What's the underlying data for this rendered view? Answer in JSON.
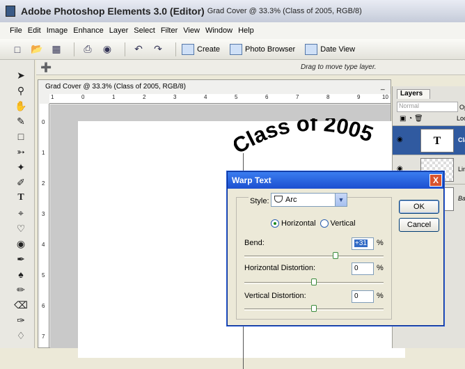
{
  "window": {
    "app_title": "Adobe Photoshop Elements 3.0 (Editor)",
    "doc_title": "Grad Cover @ 33.3% (Class of 2005, RGB/8)"
  },
  "menu": [
    "File",
    "Edit",
    "Image",
    "Enhance",
    "Layer",
    "Select",
    "Filter",
    "View",
    "Window",
    "Help"
  ],
  "toolbar": {
    "create": "Create",
    "photo_browser": "Photo Browser",
    "date_view": "Date View"
  },
  "options_bar": {
    "hint": "Drag to move type layer."
  },
  "document": {
    "title": "Grad Cover @ 33.3% (Class of 2005, RGB/8)",
    "minimize": "_",
    "ruler_top": [
      "1",
      "0",
      "1",
      "2",
      "3",
      "4",
      "5",
      "6",
      "7",
      "8",
      "9",
      "10"
    ],
    "ruler_left": [
      "0",
      "1",
      "2",
      "3",
      "4",
      "5",
      "6",
      "7"
    ],
    "canvas_text": "Class of 2005"
  },
  "layers_panel": {
    "tab": "Layers",
    "mode": "Normal",
    "opacity_label": "Op",
    "lock_label": "Loc",
    "layers": [
      {
        "thumb": "T",
        "name": "Cla",
        "active": true
      },
      {
        "thumb": "",
        "name": "Lin",
        "active": false
      },
      {
        "thumb": "",
        "name": "Ba",
        "active": false
      }
    ]
  },
  "warp_dialog": {
    "title": "Warp Text",
    "close": "X",
    "style_label": "Style:",
    "style_value": "Arc",
    "orientation": {
      "horizontal": "Horizontal",
      "vertical": "Vertical",
      "selected": "horizontal"
    },
    "bend": {
      "label": "Bend:",
      "value": "+31",
      "unit": "%",
      "level_percent": 31
    },
    "h_distortion": {
      "label": "Horizontal Distortion:",
      "value": "0",
      "unit": "%",
      "level_percent": 0
    },
    "v_distortion": {
      "label": "Vertical Distortion:",
      "value": "0",
      "unit": "%",
      "level_percent": 0
    },
    "ok": "OK",
    "cancel": "Cancel"
  },
  "icons": {
    "toolbar": [
      "new-icon",
      "open-icon",
      "save-icon",
      "print-icon",
      "online-icon",
      "undo-icon",
      "redo-icon"
    ],
    "tools": [
      "move-icon",
      "zoom-icon",
      "hand-icon",
      "eyedropper-icon",
      "marquee-icon",
      "lasso-icon",
      "magic-wand-icon",
      "selection-brush-icon",
      "type-icon",
      "crop-icon",
      "cookie-cutter-icon",
      "red-eye-icon",
      "healing-brush-icon",
      "clone-stamp-icon",
      "pencil-icon",
      "eraser-icon",
      "brush-icon",
      "paint-bucket-icon"
    ]
  },
  "colors": {
    "accent": "#1c4fd0",
    "close": "#d8532e",
    "selected_layer": "#305aa0"
  }
}
